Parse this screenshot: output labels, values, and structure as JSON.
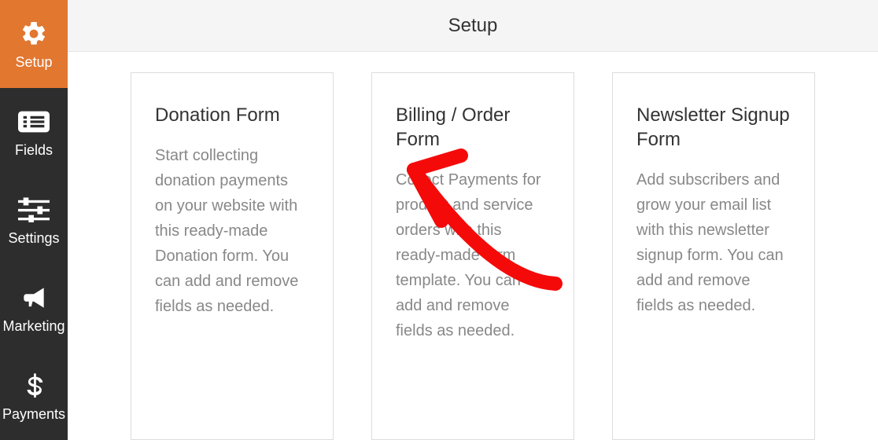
{
  "header": {
    "title": "Setup"
  },
  "sidebar": {
    "items": [
      {
        "label": "Setup",
        "icon": "gear-icon",
        "active": true
      },
      {
        "label": "Fields",
        "icon": "list-icon",
        "active": false
      },
      {
        "label": "Settings",
        "icon": "sliders-icon",
        "active": false
      },
      {
        "label": "Marketing",
        "icon": "bullhorn-icon",
        "active": false
      },
      {
        "label": "Payments",
        "icon": "dollar-icon",
        "active": false
      }
    ]
  },
  "cards": [
    {
      "title": "Donation Form",
      "desc": "Start collecting donation payments on your website with this ready-made Donation form. You can add and remove fields as needed."
    },
    {
      "title": "Billing / Order Form",
      "desc": "Collect Payments for product and service orders with this ready-made form template. You can add and remove fields as needed."
    },
    {
      "title": "Newsletter Signup Form",
      "desc": "Add subscribers and grow your email list with this newsletter signup form. You can add and remove fields as needed."
    }
  ],
  "annotation": {
    "color": "#f50a0a"
  }
}
